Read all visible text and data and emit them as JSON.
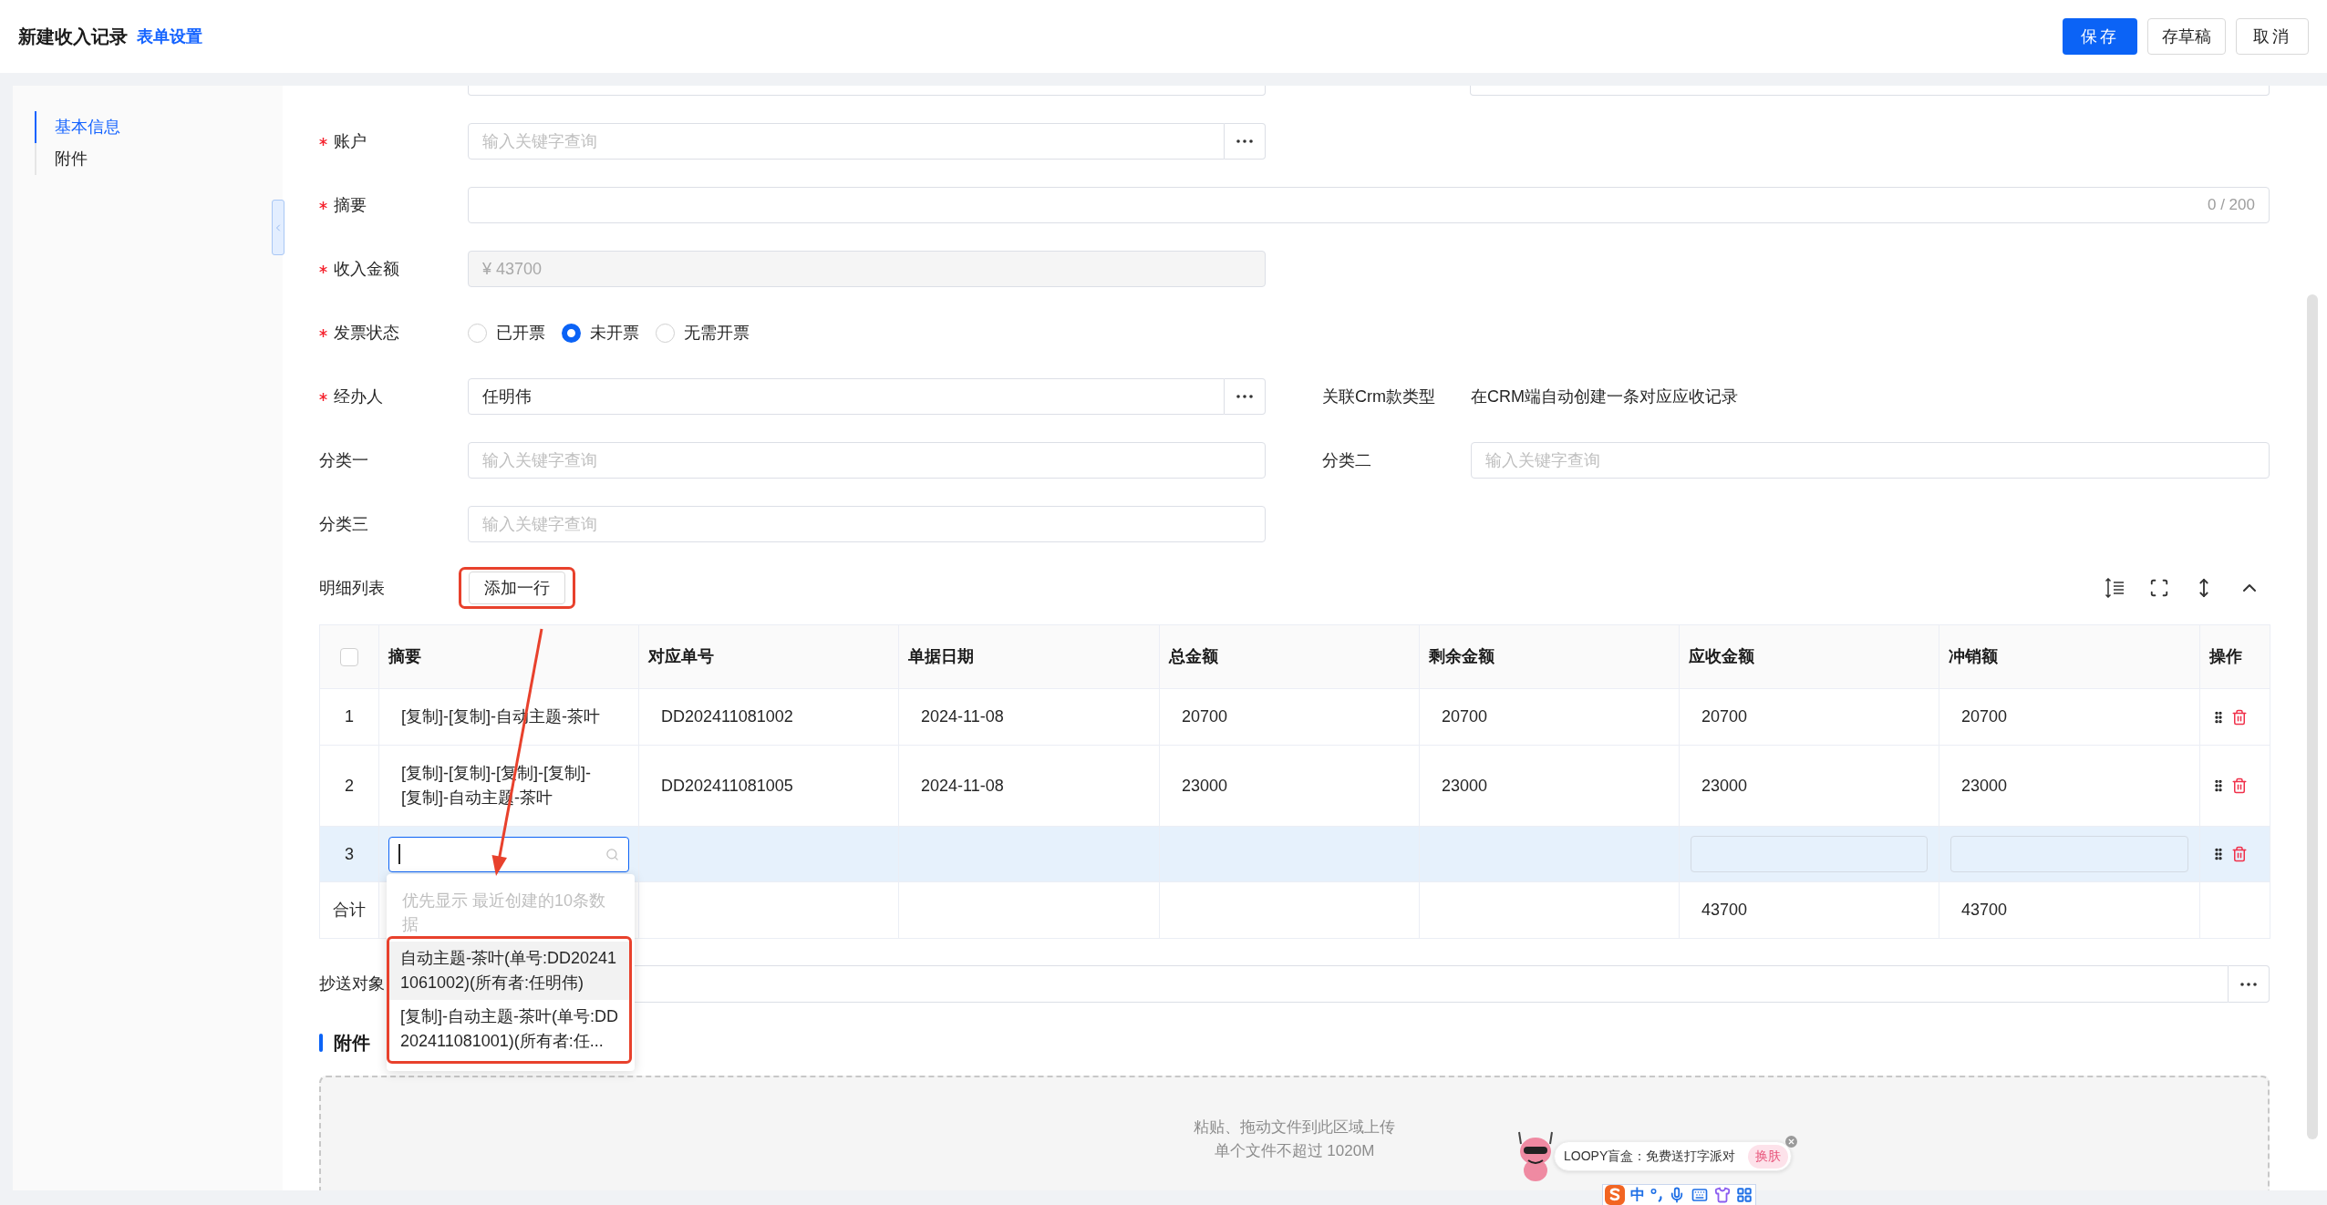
{
  "header": {
    "title": "新建收入记录",
    "settings_link": "表单设置",
    "buttons": [
      {
        "label": "保存",
        "kind": "save"
      },
      {
        "label": "存草稿",
        "kind": "draft"
      },
      {
        "label": "取消",
        "kind": "cancel"
      }
    ]
  },
  "sidebar": {
    "items": [
      {
        "label": "基本信息",
        "selected": true
      },
      {
        "label": "附件",
        "selected": false
      }
    ]
  },
  "form": {
    "rows": [
      {
        "fields": [
          {
            "kind": "lookup",
            "label": "账户",
            "required": true,
            "placeholder": "输入关键字查询"
          }
        ]
      },
      {
        "fields": [
          {
            "kind": "textarea",
            "label": "摘要",
            "required": true,
            "counter": "0 / 200"
          }
        ]
      },
      {
        "fields": [
          {
            "kind": "amount",
            "label": "收入金额",
            "required": true,
            "value": "¥ 43700",
            "disabled": true
          }
        ]
      },
      {
        "fields": [
          {
            "kind": "radio",
            "label": "发票状态",
            "required": true,
            "options": [
              {
                "label": "已开票",
                "selected": false
              },
              {
                "label": "未开票",
                "selected": true
              },
              {
                "label": "无需开票",
                "selected": false
              }
            ]
          }
        ]
      },
      {
        "fields": [
          {
            "kind": "lookup",
            "label": "经办人",
            "required": true,
            "value": "任明伟"
          },
          {
            "kind": "text",
            "label": "关联Crm款类型",
            "required": false,
            "value": "在CRM端自动创建一条对应应收记录"
          }
        ]
      },
      {
        "fields": [
          {
            "kind": "search",
            "label": "分类一",
            "required": false,
            "placeholder": "输入关键字查询"
          },
          {
            "kind": "search",
            "label": "分类二",
            "required": false,
            "placeholder": "输入关键字查询"
          }
        ]
      },
      {
        "fields": [
          {
            "kind": "search",
            "label": "分类三",
            "required": false,
            "placeholder": "输入关键字查询"
          }
        ]
      }
    ]
  },
  "details": {
    "title": "明细列表",
    "add_button": "添加一行",
    "table": {
      "select_all_checked": false,
      "columns": [
        "摘要",
        "对应单号",
        "单据日期",
        "总金额",
        "剩余金额",
        "应收金额",
        "冲销额",
        "操作"
      ],
      "rows": [
        {
          "index": "1",
          "selected": false,
          "cells": [
            {
              "kind": "text",
              "text": "[复制]-[复制]-自动主题-茶叶"
            },
            {
              "kind": "text",
              "text": "DD202411081002"
            },
            {
              "kind": "text",
              "text": "2024-11-08"
            },
            {
              "kind": "text",
              "text": "20700"
            },
            {
              "kind": "text",
              "text": "20700"
            },
            {
              "kind": "text",
              "text": "20700"
            },
            {
              "kind": "text",
              "text": "20700"
            }
          ]
        },
        {
          "index": "2",
          "selected": false,
          "cells": [
            {
              "kind": "text",
              "text": "[复制]-[复制]-[复制]-[复制]-[复制]-自动主题-茶叶"
            },
            {
              "kind": "text",
              "text": "DD202411081005"
            },
            {
              "kind": "text",
              "text": "2024-11-08"
            },
            {
              "kind": "text",
              "text": "23000"
            },
            {
              "kind": "text",
              "text": "23000"
            },
            {
              "kind": "text",
              "text": "23000"
            },
            {
              "kind": "text",
              "text": "23000"
            }
          ]
        },
        {
          "index": "3",
          "selected": true,
          "cells": [
            {
              "kind": "search_input",
              "focused": true
            },
            {
              "kind": "empty"
            },
            {
              "kind": "empty"
            },
            {
              "kind": "empty"
            },
            {
              "kind": "empty"
            },
            {
              "kind": "input"
            },
            {
              "kind": "input"
            }
          ]
        }
      ],
      "total": {
        "label": "合计",
        "cells": [
          {
            "kind": "empty"
          },
          {
            "kind": "empty"
          },
          {
            "kind": "empty"
          },
          {
            "kind": "empty"
          },
          {
            "kind": "empty"
          },
          {
            "kind": "text",
            "text": "43700"
          },
          {
            "kind": "text",
            "text": "43700"
          }
        ]
      }
    },
    "dropdown": {
      "hint": "优先显示 最近创建的10条数据",
      "options": [
        {
          "text": "自动主题-茶叶(单号:DD202411061002)(所有者:任明伟)",
          "selected": true
        },
        {
          "text": "[复制]-自动主题-茶叶(单号:DD202411081001)(所有者:任...",
          "selected": false
        }
      ]
    }
  },
  "cc": {
    "label": "抄送对象"
  },
  "attachments": {
    "title": "附件",
    "dropzone_lines": [
      "粘贴、拖动文件到此区域上传",
      "单个文件不超过 1020M"
    ]
  },
  "annotations": {
    "highlight_add_button": true,
    "highlight_options": true,
    "arrow": true
  },
  "ime": {
    "promo": "LOOPY盲盒：免费送打字派对",
    "skin_button": "换肤",
    "mode": "中"
  }
}
